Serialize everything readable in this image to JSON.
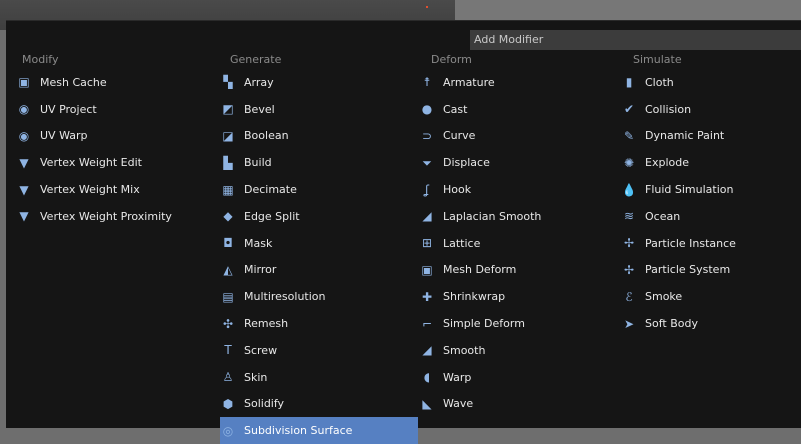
{
  "menu": {
    "title": "Add Modifier",
    "columns": [
      {
        "header": "Modify",
        "items": [
          {
            "label": "Mesh Cache",
            "icon": "mesh-cache-icon",
            "glyph": "▣"
          },
          {
            "label": "UV Project",
            "icon": "uv-project-icon",
            "glyph": "◉"
          },
          {
            "label": "UV Warp",
            "icon": "uv-warp-icon",
            "glyph": "◉"
          },
          {
            "label": "Vertex Weight Edit",
            "icon": "vertex-weight-icon",
            "glyph": "▼"
          },
          {
            "label": "Vertex Weight Mix",
            "icon": "vertex-weight-icon",
            "glyph": "▼"
          },
          {
            "label": "Vertex Weight Proximity",
            "icon": "vertex-weight-icon",
            "glyph": "▼"
          }
        ]
      },
      {
        "header": "Generate",
        "items": [
          {
            "label": "Array",
            "icon": "array-icon",
            "glyph": "▚"
          },
          {
            "label": "Bevel",
            "icon": "bevel-icon",
            "glyph": "◩"
          },
          {
            "label": "Boolean",
            "icon": "boolean-icon",
            "glyph": "◪"
          },
          {
            "label": "Build",
            "icon": "build-icon",
            "glyph": "▙"
          },
          {
            "label": "Decimate",
            "icon": "decimate-icon",
            "glyph": "▦"
          },
          {
            "label": "Edge Split",
            "icon": "edge-split-icon",
            "glyph": "◆"
          },
          {
            "label": "Mask",
            "icon": "mask-icon",
            "glyph": "◘"
          },
          {
            "label": "Mirror",
            "icon": "mirror-icon",
            "glyph": "◭"
          },
          {
            "label": "Multiresolution",
            "icon": "multiresolution-icon",
            "glyph": "▤"
          },
          {
            "label": "Remesh",
            "icon": "remesh-icon",
            "glyph": "✣"
          },
          {
            "label": "Screw",
            "icon": "screw-icon",
            "glyph": "T"
          },
          {
            "label": "Skin",
            "icon": "skin-icon",
            "glyph": "♙"
          },
          {
            "label": "Solidify",
            "icon": "solidify-icon",
            "glyph": "⬢"
          },
          {
            "label": "Subdivision Surface",
            "icon": "subdivision-surface-icon",
            "glyph": "◎"
          }
        ]
      },
      {
        "header": "Deform",
        "items": [
          {
            "label": "Armature",
            "icon": "armature-icon",
            "glyph": "☨"
          },
          {
            "label": "Cast",
            "icon": "cast-icon",
            "glyph": "●"
          },
          {
            "label": "Curve",
            "icon": "curve-icon",
            "glyph": "⊃"
          },
          {
            "label": "Displace",
            "icon": "displace-icon",
            "glyph": "⏷"
          },
          {
            "label": "Hook",
            "icon": "hook-icon",
            "glyph": "ʆ"
          },
          {
            "label": "Laplacian Smooth",
            "icon": "laplacian-smooth-icon",
            "glyph": "◢"
          },
          {
            "label": "Lattice",
            "icon": "lattice-icon",
            "glyph": "⊞"
          },
          {
            "label": "Mesh Deform",
            "icon": "mesh-deform-icon",
            "glyph": "▣"
          },
          {
            "label": "Shrinkwrap",
            "icon": "shrinkwrap-icon",
            "glyph": "✚"
          },
          {
            "label": "Simple Deform",
            "icon": "simple-deform-icon",
            "glyph": "⌐"
          },
          {
            "label": "Smooth",
            "icon": "smooth-icon",
            "glyph": "◢"
          },
          {
            "label": "Warp",
            "icon": "warp-icon",
            "glyph": "◖"
          },
          {
            "label": "Wave",
            "icon": "wave-icon",
            "glyph": "◣"
          }
        ]
      },
      {
        "header": "Simulate",
        "items": [
          {
            "label": "Cloth",
            "icon": "cloth-icon",
            "glyph": "▮"
          },
          {
            "label": "Collision",
            "icon": "collision-icon",
            "glyph": "✔"
          },
          {
            "label": "Dynamic Paint",
            "icon": "dynamic-paint-icon",
            "glyph": "✎"
          },
          {
            "label": "Explode",
            "icon": "explode-icon",
            "glyph": "✺"
          },
          {
            "label": "Fluid Simulation",
            "icon": "fluid-simulation-icon",
            "glyph": "💧"
          },
          {
            "label": "Ocean",
            "icon": "ocean-icon",
            "glyph": "≋"
          },
          {
            "label": "Particle Instance",
            "icon": "particle-instance-icon",
            "glyph": "✢"
          },
          {
            "label": "Particle System",
            "icon": "particle-system-icon",
            "glyph": "✢"
          },
          {
            "label": "Smoke",
            "icon": "smoke-icon",
            "glyph": "ℰ"
          },
          {
            "label": "Soft Body",
            "icon": "soft-body-icon",
            "glyph": "➤"
          }
        ]
      }
    ],
    "selected": "Subdivision Surface"
  },
  "colors": {
    "menu_bg": "#151515",
    "highlight": "#5680c2",
    "header_text": "#8a8a8a",
    "item_text": "#e8e8e8"
  }
}
